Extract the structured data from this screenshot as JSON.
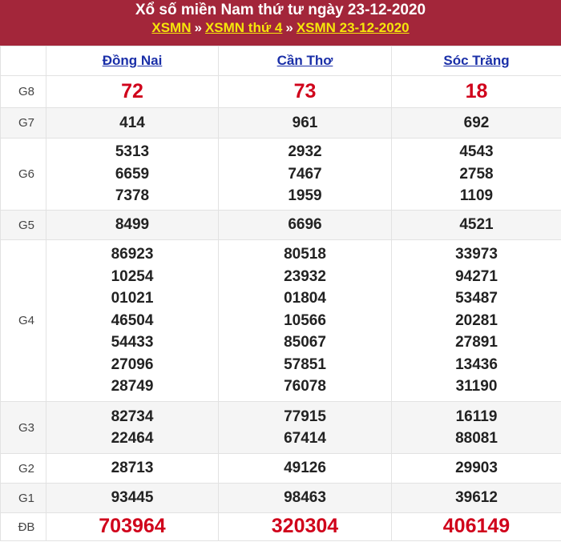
{
  "header": {
    "title": "Xổ số miền Nam thứ tư ngày 23-12-2020",
    "crumbs": [
      "XSMN",
      "XSMN thứ 4",
      "XSMN 23-12-2020"
    ],
    "separator": "»"
  },
  "provinces": [
    "Đồng Nai",
    "Cần Thơ",
    "Sóc Trăng"
  ],
  "rows": [
    {
      "label": "G8",
      "values": [
        [
          "72"
        ],
        [
          "73"
        ],
        [
          "18"
        ]
      ]
    },
    {
      "label": "G7",
      "values": [
        [
          "414"
        ],
        [
          "961"
        ],
        [
          "692"
        ]
      ]
    },
    {
      "label": "G6",
      "values": [
        [
          "5313",
          "6659",
          "7378"
        ],
        [
          "2932",
          "7467",
          "1959"
        ],
        [
          "4543",
          "2758",
          "1109"
        ]
      ]
    },
    {
      "label": "G5",
      "values": [
        [
          "8499"
        ],
        [
          "6696"
        ],
        [
          "4521"
        ]
      ]
    },
    {
      "label": "G4",
      "values": [
        [
          "86923",
          "10254",
          "01021",
          "46504",
          "54433",
          "27096",
          "28749"
        ],
        [
          "80518",
          "23932",
          "01804",
          "10566",
          "85067",
          "57851",
          "76078"
        ],
        [
          "33973",
          "94271",
          "53487",
          "20281",
          "27891",
          "13436",
          "31190"
        ]
      ]
    },
    {
      "label": "G3",
      "values": [
        [
          "82734",
          "22464"
        ],
        [
          "77915",
          "67414"
        ],
        [
          "16119",
          "88081"
        ]
      ]
    },
    {
      "label": "G2",
      "values": [
        [
          "28713"
        ],
        [
          "49126"
        ],
        [
          "29903"
        ]
      ]
    },
    {
      "label": "G1",
      "values": [
        [
          "93445"
        ],
        [
          "98463"
        ],
        [
          "39612"
        ]
      ]
    },
    {
      "label": "ĐB",
      "values": [
        [
          "703964"
        ],
        [
          "320304"
        ],
        [
          "406149"
        ]
      ]
    }
  ],
  "colors": {
    "header_bg": "#a3263a",
    "link_yellow": "#f5e60a",
    "prize_red": "#d0021b",
    "province_blue": "#1a2fa8"
  }
}
